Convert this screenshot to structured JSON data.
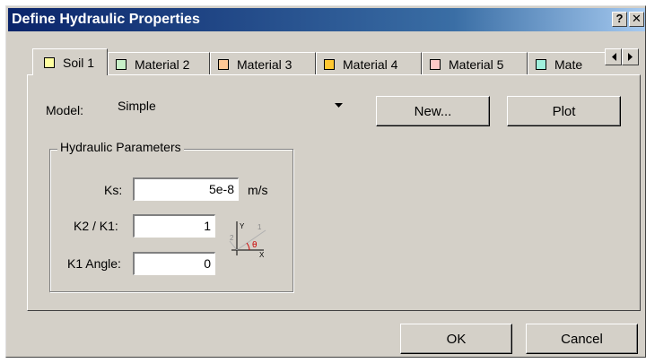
{
  "window": {
    "title": "Define Hydraulic Properties",
    "help_label": "?",
    "close_label": "✕"
  },
  "tabs": [
    {
      "label": "Soil 1",
      "swatch": "#ffffa0"
    },
    {
      "label": "Material 2",
      "swatch": "#c8f0c8"
    },
    {
      "label": "Material 3",
      "swatch": "#ffc896"
    },
    {
      "label": "Material 4",
      "swatch": "#ffc832"
    },
    {
      "label": "Material 5",
      "swatch": "#ffc8c8"
    },
    {
      "label": "Mate",
      "swatch": "#a0f0dc"
    }
  ],
  "model": {
    "label": "Model:",
    "value": "Simple"
  },
  "buttons": {
    "new": "New...",
    "plot": "Plot",
    "ok": "OK",
    "cancel": "Cancel"
  },
  "hydraulic": {
    "group_title": "Hydraulic Parameters",
    "ks_label": "Ks:",
    "ks_value": "5e-8",
    "ks_unit": "m/s",
    "k2k1_label": "K2 / K1:",
    "k2k1_value": "1",
    "angle_label": "K1 Angle:",
    "angle_value": "0"
  },
  "diagram": {
    "y": "Y",
    "x": "X",
    "one": "1",
    "two": "2",
    "theta": "θ"
  }
}
